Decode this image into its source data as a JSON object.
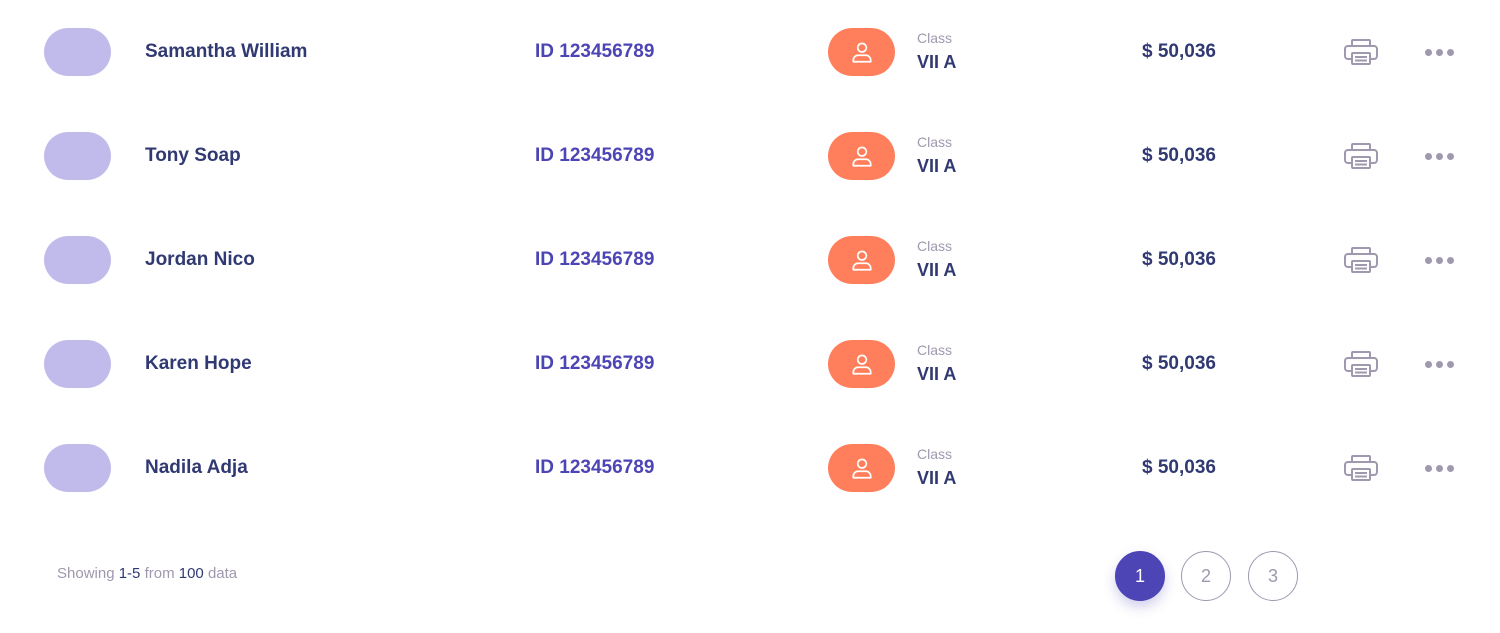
{
  "rows": [
    {
      "name": "Samantha William",
      "id": "ID 123456789",
      "class_label": "Class",
      "class_value": "VII A",
      "amount": "$ 50,036"
    },
    {
      "name": "Tony Soap",
      "id": "ID 123456789",
      "class_label": "Class",
      "class_value": "VII A",
      "amount": "$ 50,036"
    },
    {
      "name": "Jordan Nico",
      "id": "ID 123456789",
      "class_label": "Class",
      "class_value": "VII A",
      "amount": "$ 50,036"
    },
    {
      "name": "Karen Hope",
      "id": "ID 123456789",
      "class_label": "Class",
      "class_value": "VII A",
      "amount": "$ 50,036"
    },
    {
      "name": "Nadila Adja",
      "id": "ID 123456789",
      "class_label": "Class",
      "class_value": "VII A",
      "amount": "$ 50,036"
    }
  ],
  "icons": {
    "class_badge": "user-icon",
    "print": "printer-icon",
    "more": "more-horizontal-icon"
  },
  "colors": {
    "primary": "#4D44B5",
    "text_dark": "#303972",
    "text_muted": "#A098AE",
    "avatar_bg": "#C1BBEB",
    "badge_bg": "#FF7F5C"
  },
  "footer": {
    "showing": "Showing",
    "range": "1-5",
    "from": "from",
    "total": "100",
    "data": "data"
  },
  "pagination": {
    "pages": [
      "1",
      "2",
      "3"
    ],
    "current": "1"
  }
}
